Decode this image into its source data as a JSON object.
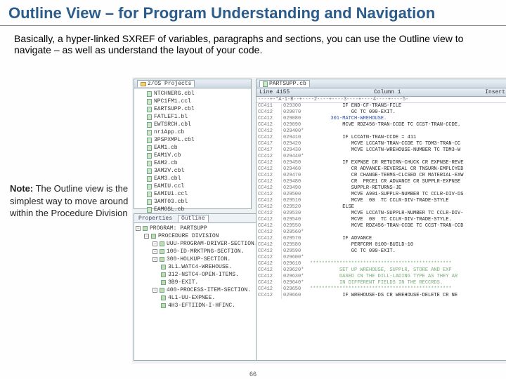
{
  "slide": {
    "title": "Outline View – for Program Understanding and Navigation",
    "body": "Basically, a hyper-linked SXREF of variables, paragraphs and sections, you can use the Outline view to navigate – as well as understand the layout of your code."
  },
  "note": {
    "label": "Note:",
    "text": " The Outline view is the simplest way to move around within the Procedure Division"
  },
  "projects": {
    "tab": "z/OS Projects",
    "items": [
      "NTCHNERG.cbl",
      "NPC1FM1.ccl",
      "EARTSUPP.cbl",
      "FATLEF1.bl",
      "EWTSRCH.cbl",
      "nr1App.cb",
      "3PSPXMPL.cbl",
      "EAM1.cb",
      "EAM1V.cb",
      "EAM2.cb",
      "3AM2V.cbl",
      "EAM3.cbl",
      "EAMIU.ccl",
      "EAMIU1.ccl",
      "3AMT03.cbl",
      "EAMOSL.cb"
    ]
  },
  "outline": {
    "tabs": {
      "properties": "Properties",
      "outline": "Outline"
    },
    "root": "PROGRAM: PARTSUPP",
    "root2": "PROCEDURE DIVISION",
    "items": [
      {
        "t": "UUU-PROGRAM-DRIVER-SECTION.",
        "i": 2
      },
      {
        "t": "100-ID-MRKTPNG-SECTION.",
        "i": 2
      },
      {
        "t": "300-HOLKUP-SECTION.",
        "i": 2
      },
      {
        "t": "3L1…WATC4-WREHOUSE.",
        "i": 3
      },
      {
        "t": "312-NSTC4-OPEN-ITEMS.",
        "i": 3
      },
      {
        "t": "3B9-EXIT.",
        "i": 3
      },
      {
        "t": "400-PROCESS-ITEM-SECTION.",
        "i": 2
      },
      {
        "t": "4L1-UU-EXPNEE.",
        "i": 3
      },
      {
        "t": "4H3-EFTIIDN-I-HFINC.",
        "i": 3
      }
    ]
  },
  "editor": {
    "tab": "PARTSUPP.cb",
    "status": {
      "line": "Line 4155",
      "col": "Column 1",
      "mode": "Insert"
    },
    "ruler": "----+-*A-1-B--+----2----+----3----+----4----+----5-",
    "rows": [
      {
        "n": "CC411",
        "s": "029300",
        "t": "           IF END-CF-TRANS-FILE",
        "c": "t"
      },
      {
        "n": "CC412",
        "s": "029070",
        "t": "              GC TC 099-EXIT.",
        "c": "t"
      },
      {
        "n": "CC412",
        "s": "029080",
        "t": "       301-MATCH-WREHOUSE.",
        "c": "h"
      },
      {
        "n": "CC412",
        "s": "029090",
        "t": "           MCVE RDZ456-TRAN-CCDE TC CCST-TRAN-CCDE.",
        "c": "t"
      },
      {
        "n": "CC412",
        "s": "029400*",
        "t": "",
        "c": "c"
      },
      {
        "n": "CC412",
        "s": "029410",
        "t": "           IF LCCATN-TRAN-CCDE = 411",
        "c": "t"
      },
      {
        "n": "CC417",
        "s": "029420",
        "t": "              MCVE LCCATN-TRAN-CCDE TC TDM3-TRAN-CC",
        "c": "t"
      },
      {
        "n": "CC417",
        "s": "029430",
        "t": "              MCVE LCCATN-WREHOUSE-NUMBER TC TDM3-W",
        "c": "t"
      },
      {
        "n": "CC412",
        "s": "029440*",
        "t": "",
        "c": "c"
      },
      {
        "n": "CC412",
        "s": "029450",
        "t": "           IF EXPNSE CR RETUIRN-CHUCK CR EXPNSE-REVE",
        "c": "t"
      },
      {
        "n": "CC412",
        "s": "029460",
        "t": "              CR ADVANCE-REVERSAL CR TNSURN-EMPLCYED",
        "c": "t"
      },
      {
        "n": "CC412",
        "s": "029470",
        "t": "              CR CHANGE-TERMS-CLCSED CR MATERIAL-EXW",
        "c": "t"
      },
      {
        "n": "CC412",
        "s": "029480",
        "t": "              CR  PRCE1 CR ADVANCE CR SUPPLR-EXPNSE",
        "c": "t"
      },
      {
        "n": "CC412",
        "s": "029490",
        "t": "              SUPPLR-RETURNS-JE",
        "c": "t"
      },
      {
        "n": "CC412",
        "s": "029500",
        "t": "              MCVE A901-SUPPLR-NUMBER TC CCLR-DIV-DS",
        "c": "t"
      },
      {
        "n": "CC412",
        "s": "029510",
        "t": "              MCVE  00  TC CCLR-DIV-TRADE-STYLE",
        "c": "t"
      },
      {
        "n": "CC412",
        "s": "029520",
        "t": "           ELSE",
        "c": "t"
      },
      {
        "n": "CC412",
        "s": "029530",
        "t": "              MCVE LCCATN-SUPPLR-NUMBER TC CCLR-DIV-",
        "c": "t"
      },
      {
        "n": "CC412",
        "s": "029540",
        "t": "              MCVE  00  TC CCLR-DIV-TRADE-STYLE.",
        "c": "t"
      },
      {
        "n": "CC412",
        "s": "029550",
        "t": "              MCVE RDZ456-TRAN-CCDE TC CCST-TRAN-CCD",
        "c": "t"
      },
      {
        "n": "CC412",
        "s": "029560*",
        "t": "",
        "c": "c"
      },
      {
        "n": "CC412",
        "s": "029570",
        "t": "           IF ADVANCE",
        "c": "t"
      },
      {
        "n": "CC412",
        "s": "029580",
        "t": "              PERFCRM 0100-BUILD-10",
        "c": "t"
      },
      {
        "n": "CC412",
        "s": "029590",
        "t": "              GC TC 099-EXIT.",
        "c": "t"
      },
      {
        "n": "CC412",
        "s": "029600*",
        "t": "",
        "c": "c"
      },
      {
        "n": "CC412",
        "s": "029610",
        "t": "************************************************",
        "c": "c"
      },
      {
        "n": "CC412",
        "s": "029620*",
        "t": "          SET UP WREHOUSE, SUPPLR, STORE AND EXP",
        "c": "c"
      },
      {
        "n": "CC412",
        "s": "029630*",
        "t": "          DASED CN THE DILL-LADING TYPE AS THEY AR",
        "c": "c"
      },
      {
        "n": "CC412",
        "s": "029640*",
        "t": "          IN DIFFERENT FIELDS IN THE RECCRDS.",
        "c": "c"
      },
      {
        "n": "CC412",
        "s": "029650",
        "t": "************************************************",
        "c": "c"
      },
      {
        "n": "CC412",
        "s": "029660",
        "t": "           IF WREHOUSE-DS CR WREHOUSE-DELETE CR NE",
        "c": "t"
      }
    ]
  },
  "page_number": "66"
}
